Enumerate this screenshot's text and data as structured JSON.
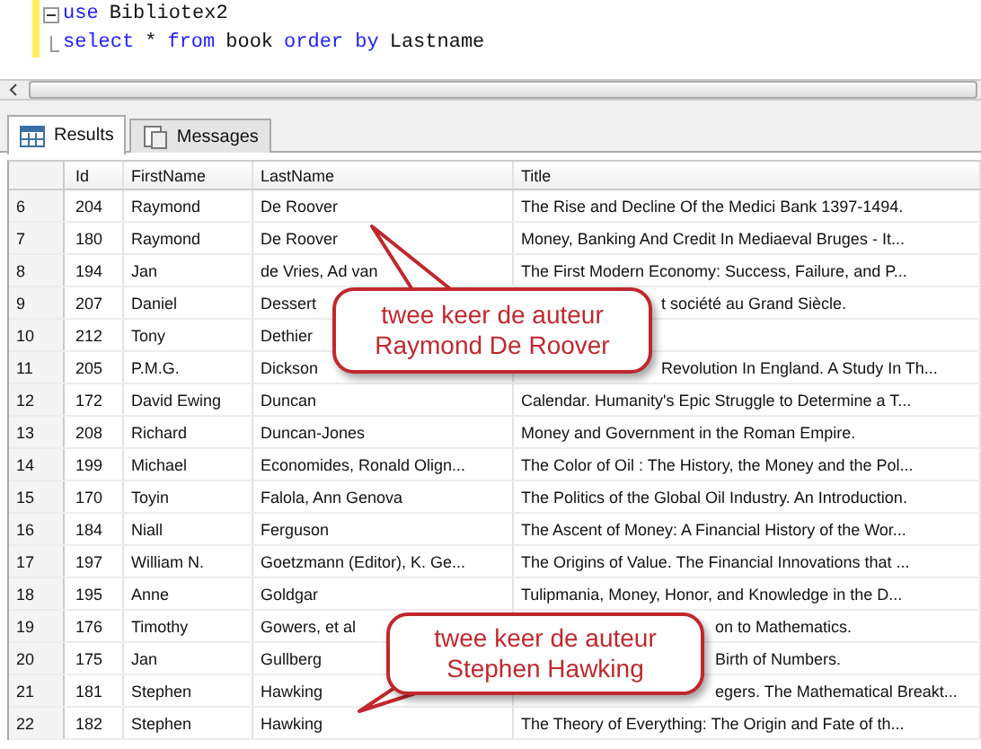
{
  "editor": {
    "lines": [
      {
        "kind": "fold",
        "tokens": [
          {
            "text": "use",
            "keyword": true
          },
          {
            "text": "Bibliotex2",
            "keyword": false
          }
        ]
      },
      {
        "kind": "end",
        "tokens": [
          {
            "text": "select",
            "keyword": true
          },
          {
            "text": "*",
            "keyword": false
          },
          {
            "text": "from",
            "keyword": true
          },
          {
            "text": "book",
            "keyword": false
          },
          {
            "text": "order by",
            "keyword": true
          },
          {
            "text": "Lastname",
            "keyword": false
          }
        ]
      }
    ]
  },
  "tabs": [
    {
      "label": "Results",
      "selected": true
    },
    {
      "label": "Messages",
      "selected": false
    }
  ],
  "table": {
    "columns": [
      "Id",
      "FirstName",
      "LastName",
      "Title"
    ],
    "rows": [
      {
        "num": "6",
        "cells": [
          "204",
          "Raymond",
          "De Roover",
          "The Rise and Decline Of the Medici Bank 1397-1494."
        ]
      },
      {
        "num": "7",
        "cells": [
          "180",
          "Raymond",
          "De Roover",
          "Money, Banking And Credit In Mediaeval Bruges - It..."
        ]
      },
      {
        "num": "8",
        "cells": [
          "194",
          "Jan",
          "de Vries, Ad van",
          "The First Modern Economy: Success, Failure, and P..."
        ]
      },
      {
        "num": "9",
        "cells": [
          "207",
          "Daniel",
          "Dessert",
          "t société au Grand Siècle."
        ]
      },
      {
        "num": "10",
        "cells": [
          "212",
          "Tony",
          "Dethier",
          ""
        ]
      },
      {
        "num": "11",
        "cells": [
          "205",
          "P.M.G.",
          "Dickson",
          "Revolution In England. A Study In Th..."
        ]
      },
      {
        "num": "12",
        "cells": [
          "172",
          "David Ewing",
          "Duncan",
          "Calendar. Humanity's Epic Struggle to Determine a T..."
        ]
      },
      {
        "num": "13",
        "cells": [
          "208",
          "Richard",
          "Duncan-Jones",
          "Money and Government in the Roman Empire."
        ]
      },
      {
        "num": "14",
        "cells": [
          "199",
          "Michael",
          "Economides, Ronald Olign...",
          "The Color of Oil : The History, the Money and the Pol..."
        ]
      },
      {
        "num": "15",
        "cells": [
          "170",
          "Toyin",
          "Falola, Ann Genova",
          "The Politics of the Global Oil Industry. An Introduction."
        ]
      },
      {
        "num": "16",
        "cells": [
          "184",
          "Niall",
          "Ferguson",
          "The Ascent of Money: A Financial History of the Wor..."
        ]
      },
      {
        "num": "17",
        "cells": [
          "197",
          "William N.",
          "Goetzmann (Editor), K. Ge...",
          "The Origins of Value. The Financial Innovations that ..."
        ]
      },
      {
        "num": "18",
        "cells": [
          "195",
          "Anne",
          "Goldgar",
          "Tulipmania, Money, Honor, and Knowledge in the D..."
        ]
      },
      {
        "num": "19",
        "cells": [
          "176",
          "Timothy",
          "Gowers, et al",
          "on to Mathematics."
        ]
      },
      {
        "num": "20",
        "cells": [
          "175",
          "Jan",
          "Gullberg",
          "Birth of Numbers."
        ]
      },
      {
        "num": "21",
        "cells": [
          "181",
          "Stephen",
          "Hawking",
          "egers. The Mathematical Breakt..."
        ]
      },
      {
        "num": "22",
        "cells": [
          "182",
          "Stephen",
          "Hawking",
          "The Theory of Everything: The Origin and Fate of th..."
        ]
      }
    ]
  },
  "callouts": [
    {
      "lines": [
        "twee keer de auteur",
        "Raymond De Roover"
      ]
    },
    {
      "lines": [
        "twee keer de auteur",
        "Stephen Hawking"
      ]
    }
  ]
}
